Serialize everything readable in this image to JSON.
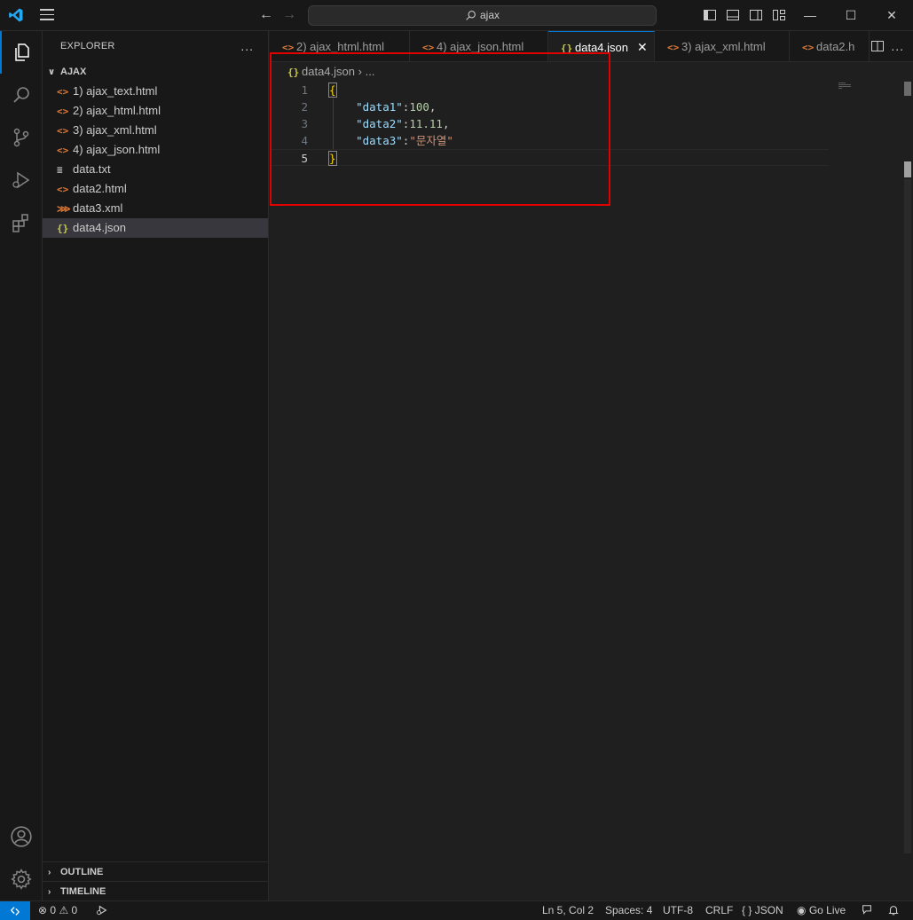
{
  "titlebar": {
    "search_text": "ajax",
    "logo_icon": "vscode-logo-icon",
    "back_icon": "arrow-left-icon",
    "forward_icon": "arrow-right-icon"
  },
  "activity": [
    {
      "name": "explorer-icon"
    },
    {
      "name": "search-icon"
    },
    {
      "name": "source-control-icon"
    },
    {
      "name": "run-debug-icon"
    },
    {
      "name": "extensions-icon"
    },
    {
      "name": "account-icon"
    },
    {
      "name": "settings-gear-icon"
    }
  ],
  "sidebar": {
    "title": "EXPLORER",
    "more": "...",
    "folder": "AJAX",
    "files": [
      {
        "label": "1) ajax_text.html",
        "icon": "<>"
      },
      {
        "label": "2) ajax_html.html",
        "icon": "<>"
      },
      {
        "label": "3) ajax_xml.html",
        "icon": "<>"
      },
      {
        "label": "4) ajax_json.html",
        "icon": "<>"
      },
      {
        "label": "data.txt",
        "icon": "≡"
      },
      {
        "label": "data2.html",
        "icon": "<>"
      },
      {
        "label": "data3.xml",
        "icon": "⋙"
      },
      {
        "label": "data4.json",
        "icon": "{}"
      }
    ],
    "outline": "OUTLINE",
    "timeline": "TIMELINE"
  },
  "tabs": [
    {
      "label": "2) ajax_html.html",
      "icon": "<>"
    },
    {
      "label": "4) ajax_json.html",
      "icon": "<>"
    },
    {
      "label": "data4.json",
      "icon": "{}",
      "close": "✕"
    },
    {
      "label": "3) ajax_xml.html",
      "icon": "<>"
    },
    {
      "label": "data2.h",
      "icon": "<>"
    }
  ],
  "editor": {
    "breadcrumb_file": "data4.json",
    "breadcrumb_sep": "›",
    "breadcrumb_rest": "...",
    "lines": [
      {
        "n": "1",
        "open": "{"
      },
      {
        "n": "2",
        "key": "\"data1\"",
        "colon": ":",
        "value": "100",
        "comma": ","
      },
      {
        "n": "3",
        "key": "\"data2\"",
        "colon": ":",
        "value": "11.11",
        "comma": ","
      },
      {
        "n": "4",
        "key": "\"data3\"",
        "colon": ":",
        "value": "\"문자열\""
      },
      {
        "n": "5",
        "close": "}"
      }
    ]
  },
  "status": {
    "errors": "0",
    "warnings": "0",
    "position": "Ln 5, Col 2",
    "spaces": "Spaces: 4",
    "encoding": "UTF-8",
    "eol": "CRLF",
    "language": "JSON",
    "language_icon": "{ }",
    "golive": "Go Live"
  },
  "colors": {
    "accent": "#0078d4",
    "highlight_box": "#e00000",
    "json_key": "#9cdcfe",
    "json_number": "#b5cea8",
    "json_string": "#ce9178",
    "brace": "#ffd700"
  }
}
